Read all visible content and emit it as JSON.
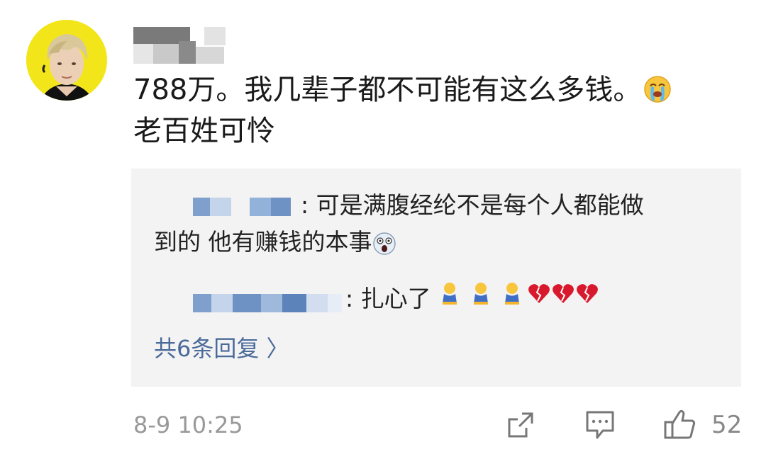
{
  "comment": {
    "author_avatar": "avatar",
    "line1": "788万。我几辈子都不可能有这么多钱。",
    "line1_emoji": "crying-emoji",
    "line2": "老百姓可怜"
  },
  "replies": [
    {
      "text_line1": ": 可是满腹经纶不是每个人都能做",
      "text_line2": "到的  他有赚钱的本事",
      "emoji": "scared-emoji"
    },
    {
      "text": ": 扎心了",
      "emojis": [
        "sad-kneeling-emoji",
        "sad-kneeling-emoji",
        "sad-kneeling-emoji",
        "broken-heart-emoji",
        "broken-heart-emoji",
        "broken-heart-emoji"
      ]
    }
  ],
  "more_replies_label": "共6条回复 〉",
  "timestamp": "8-9 10:25",
  "actions": {
    "share_icon": "share-icon",
    "comment_icon": "comment-icon",
    "like_icon": "thumbs-up-icon",
    "like_count": "52"
  },
  "colors": {
    "link": "#4a6a9a",
    "meta": "#999999",
    "reply_bg": "#f3f3f3",
    "blur_blue": "#7fa0cc",
    "broken_heart": "#d8192d"
  }
}
